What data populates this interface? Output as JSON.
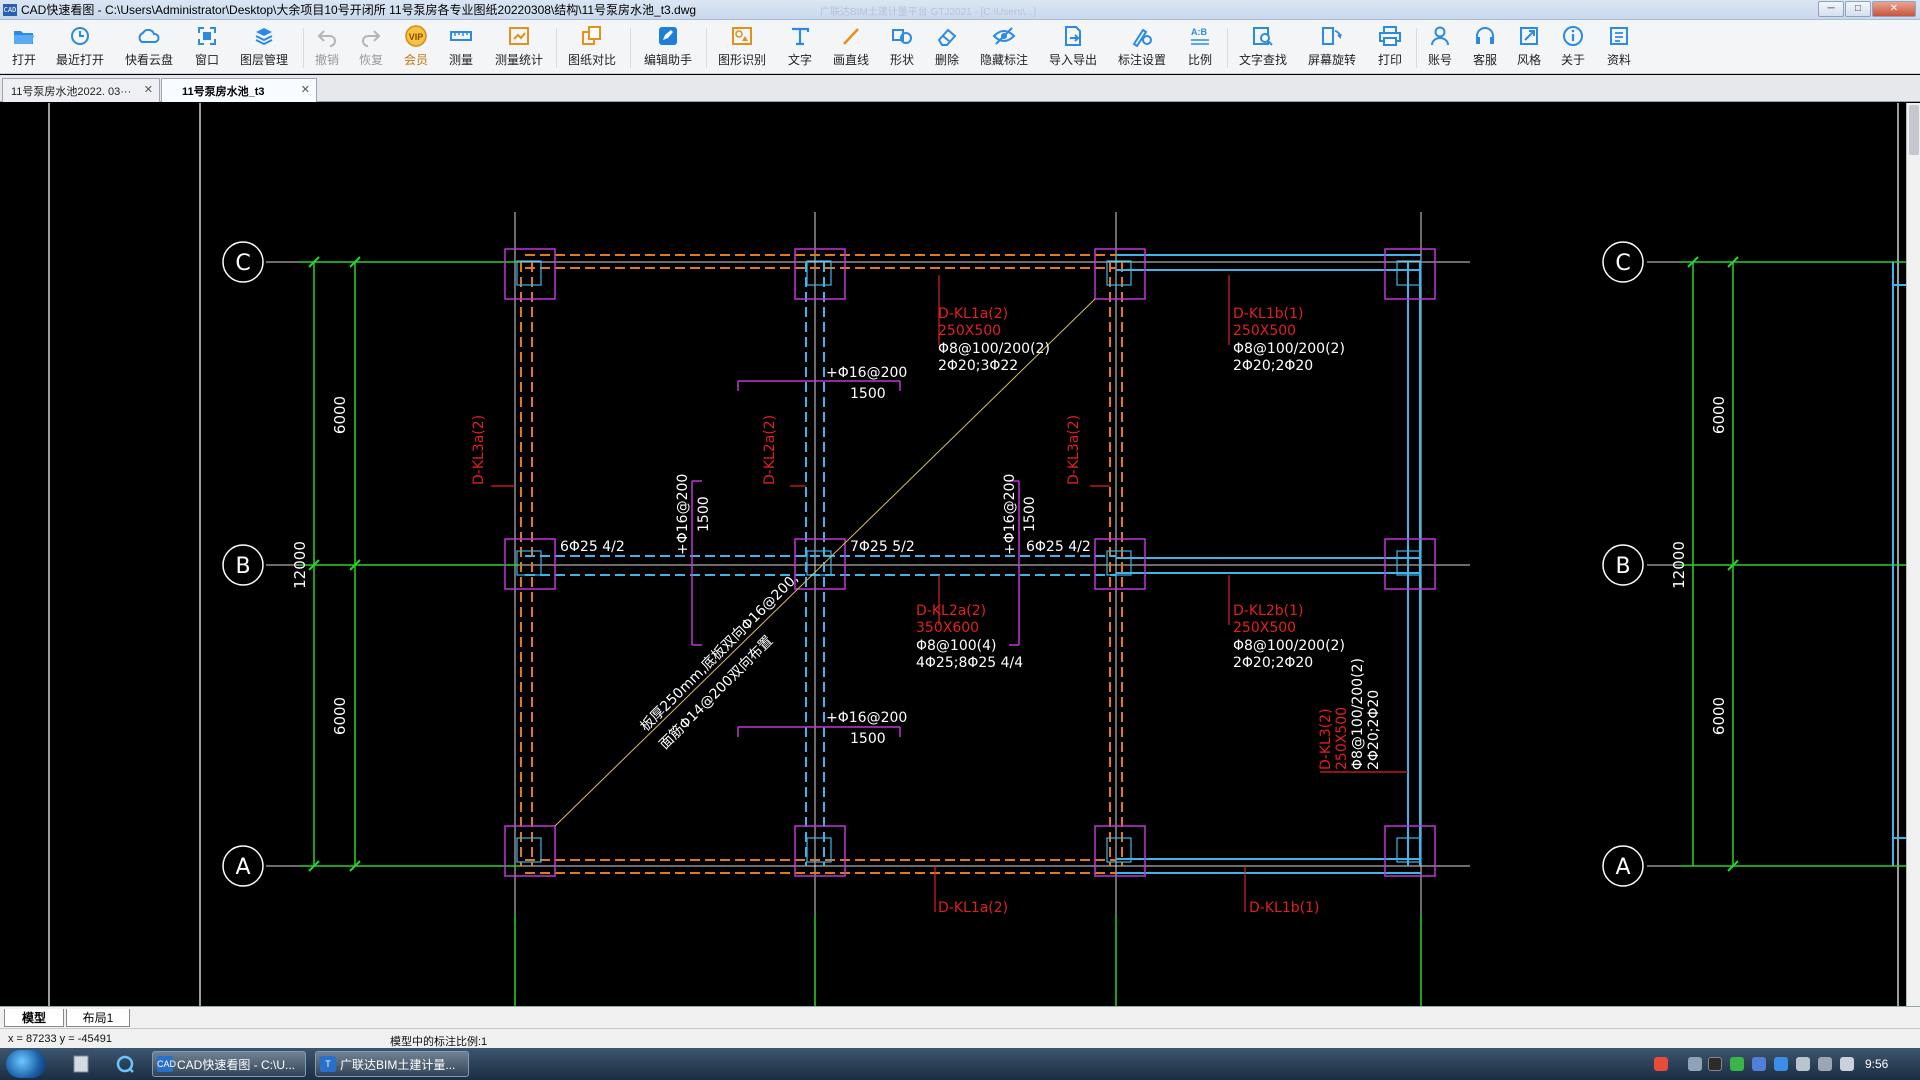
{
  "window": {
    "app_icon_text": "CAD",
    "title": "CAD快速看图 - C:\\Users\\Administrator\\Desktop\\大余项目10号开闭所 11号泵房各专业图纸20220308\\结构\\11号泵房水池_t3.dwg",
    "ghost_text": "广联达BIM土建计量平台 GTJ2021 - [C:\\Users\\...]",
    "minimize": "─",
    "maximize": "□",
    "close": "✕"
  },
  "toolbar": {
    "items": [
      {
        "id": "open",
        "label": "打开",
        "icon": "folder-open-icon"
      },
      {
        "id": "recent",
        "label": "最近打开",
        "icon": "history-icon"
      },
      {
        "id": "cloud",
        "label": "快看云盘",
        "icon": "cloud-icon"
      },
      {
        "id": "window",
        "label": "窗口",
        "icon": "window-icon"
      },
      {
        "id": "layers",
        "label": "图层管理",
        "icon": "layers-icon"
      },
      {
        "id": "undo",
        "label": "撤销",
        "icon": "undo-icon",
        "disabled": true
      },
      {
        "id": "redo",
        "label": "恢复",
        "icon": "redo-icon",
        "disabled": true
      },
      {
        "id": "vip",
        "label": "会员",
        "icon": "vip-icon",
        "vip": true
      },
      {
        "id": "measure",
        "label": "测量",
        "icon": "measure-icon"
      },
      {
        "id": "measure-stats",
        "label": "测量统计",
        "icon": "measure-stats-icon"
      },
      {
        "id": "compare",
        "label": "图纸对比",
        "icon": "compare-icon"
      },
      {
        "id": "edit-assist",
        "label": "编辑助手",
        "icon": "edit-assist-icon"
      },
      {
        "id": "shape-recog",
        "label": "图形识别",
        "icon": "shape-recognize-icon"
      },
      {
        "id": "text",
        "label": "文字",
        "icon": "text-icon"
      },
      {
        "id": "line",
        "label": "画直线",
        "icon": "line-icon"
      },
      {
        "id": "shape",
        "label": "形状",
        "icon": "shape-icon"
      },
      {
        "id": "delete",
        "label": "删除",
        "icon": "eraser-icon"
      },
      {
        "id": "hide-mark",
        "label": "隐藏标注",
        "icon": "hide-eye-icon"
      },
      {
        "id": "import-export",
        "label": "导入导出",
        "icon": "import-export-icon"
      },
      {
        "id": "mark-settings",
        "label": "标注设置",
        "icon": "mark-settings-icon"
      },
      {
        "id": "scale",
        "label": "比例",
        "icon": "scale-icon"
      },
      {
        "id": "text-search",
        "label": "文字查找",
        "icon": "text-search-icon"
      },
      {
        "id": "rotate",
        "label": "屏幕旋转",
        "icon": "rotate-screen-icon"
      },
      {
        "id": "print",
        "label": "打印",
        "icon": "printer-icon"
      },
      {
        "id": "account",
        "label": "账号",
        "icon": "user-icon"
      },
      {
        "id": "support",
        "label": "客服",
        "icon": "headset-icon"
      },
      {
        "id": "style",
        "label": "风格",
        "icon": "style-icon"
      },
      {
        "id": "about",
        "label": "关于",
        "icon": "info-icon"
      },
      {
        "id": "resources",
        "label": "资料",
        "icon": "resources-icon"
      }
    ]
  },
  "tabs": [
    {
      "label": "11号泵房水池2022. 03···",
      "close": "✕",
      "active": false
    },
    {
      "label": "11号泵房水池_t3",
      "close": "✕",
      "active": true
    }
  ],
  "drawing": {
    "axes": {
      "C": "C",
      "B": "B",
      "A": "A"
    },
    "dims_left": {
      "top": "6000",
      "bottom": "6000",
      "total": "12000"
    },
    "dims_right": {
      "top": "6000",
      "bottom": "6000",
      "total": "12000"
    },
    "beams": {
      "kl1a_top": [
        "D-KL1a(2)",
        "250X500",
        "Φ8@100/200(2)",
        "2Φ20;3Φ22"
      ],
      "kl1b_top": [
        "D-KL1b(1)",
        "250X500",
        "Φ8@100/200(2)",
        "2Φ20;2Φ20"
      ],
      "kl2a": [
        "D-KL2a(2)",
        "350X600",
        "Φ8@100(4)",
        "4Φ25;8Φ25 4/4"
      ],
      "kl2b": [
        "D-KL2b(1)",
        "250X500",
        "Φ8@100/200(2)",
        "2Φ20;2Φ20"
      ],
      "kl3": [
        "D-KL3(2)",
        "250X500",
        "Φ8@100/200(2)",
        "2Φ20;2Φ20"
      ],
      "kl1a_bottom": "D-KL1a(2)",
      "kl1b_bottom": "D-KL1b(1)",
      "kl3a_left": "D-KL3a(2)",
      "kl2a_vert": "D-KL2a(2)",
      "kl3a_mid": "D-KL3a(2)"
    },
    "rebar": {
      "top_note": "+Φ16@200",
      "top_len": "1500",
      "bottom_note": "+Φ16@200",
      "bottom_len": "1500",
      "left_note": "+Φ16@200",
      "left_len": "1500",
      "right_note": "+Φ16@200",
      "right_len": "1500",
      "r1": "6Φ25 4/2",
      "r2": "7Φ25 5/2",
      "r3": "6Φ25 4/2"
    },
    "slab_note_1": "板厚250mm,底板双向Φ16@200,",
    "slab_note_2": "面筋Φ14@200双向布置"
  },
  "layout_tabs": [
    {
      "label": "模型",
      "active": true
    },
    {
      "label": "布局1",
      "active": false
    }
  ],
  "status": {
    "coords": "x = 87233  y = -45491",
    "scale_info": "模型中的标注比例:1"
  },
  "taskbar": {
    "items": [
      {
        "label": "CAD快速看图 - C:\\U...",
        "icon_text": "CAD"
      },
      {
        "label": "广联达BIM土建计量...",
        "icon_text": "T"
      }
    ],
    "clock": "9:56"
  }
}
